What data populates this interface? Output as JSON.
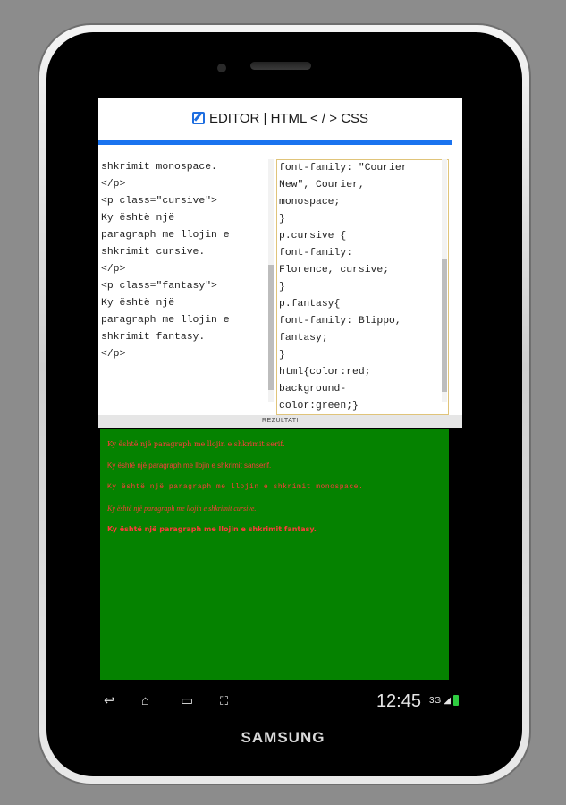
{
  "device": {
    "brand": "SAMSUNG"
  },
  "header": {
    "title": "EDITOR | HTML < / > CSS",
    "icon": "edit-icon"
  },
  "html_editor": {
    "lines": [
      "shkrimit monospace.",
      "</p>",
      "<p class=\"cursive\">",
      "Ky është një",
      "paragraph me llojin e",
      "shkrimit cursive.",
      "</p>",
      "<p class=\"fantasy\">",
      "Ky është një",
      "paragraph me llojin e",
      "shkrimit fantasy.",
      "</p>"
    ]
  },
  "css_editor": {
    "lines": [
      "font-family: \"Courier",
      "New\", Courier,",
      "monospace;",
      "}",
      "p.cursive {",
      "font-family:",
      "Florence, cursive;",
      "}",
      "p.fantasy{",
      "font-family: Blippo,",
      "fantasy;",
      "}",
      "html{color:red;",
      "background-",
      "color:green;}"
    ]
  },
  "result_bar": {
    "label": "REZULTATI"
  },
  "result": {
    "background": "#058200",
    "text_color": "#ff3b3b",
    "paragraphs": [
      "Ky është një paragraph me llojin e shkrimit serif.",
      "Ky është një paragraph me llojin e shkrimit sanserif.",
      "Ky është një paragraph me llojin e shkrimit monospace.",
      "Ky është një paragraph me llojin e shkrimit cursive.",
      "Ky është një paragraph me llojin e shkrimit fantasy."
    ]
  },
  "statusbar": {
    "time": "12:45",
    "signal": "3G"
  },
  "nav": {
    "back": "back-icon",
    "home": "home-icon",
    "recent": "recent-apps-icon",
    "screenshot": "screenshot-icon"
  }
}
